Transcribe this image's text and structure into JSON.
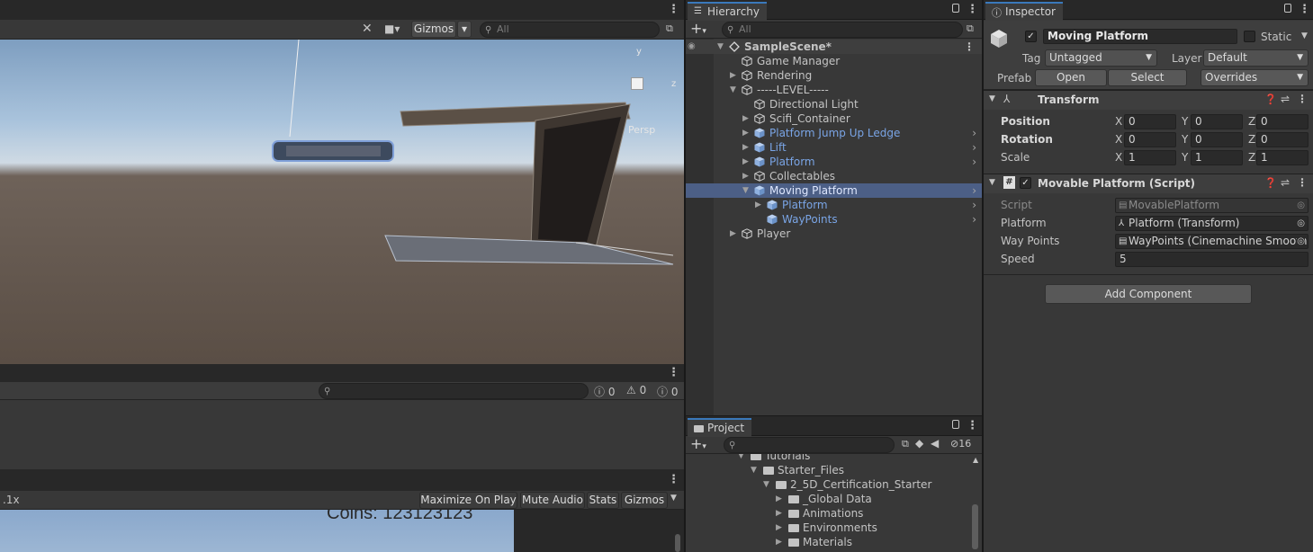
{
  "scene_view": {
    "gizmos_label": "Gizmos",
    "search_placeholder": "All",
    "persp_label": "Persp",
    "axis_y": "y",
    "axis_z": "z"
  },
  "console": {
    "count_info": "0",
    "count_warn": "0",
    "count_error": "0"
  },
  "game_view": {
    "scale_label": ".1x",
    "maximize_label": "Maximize On Play",
    "mute_label": "Mute Audio",
    "stats_label": "Stats",
    "gizmos_label": "Gizmos",
    "coins_text": "Coins: 123123123"
  },
  "hierarchy": {
    "tab_label": "Hierarchy",
    "search_placeholder": "All",
    "items": [
      {
        "label": "SampleScene*",
        "indent": 0,
        "type": "scene"
      },
      {
        "label": "Game Manager",
        "indent": 1,
        "type": "object"
      },
      {
        "label": "Rendering",
        "indent": 1,
        "type": "object"
      },
      {
        "label": "-----LEVEL-----",
        "indent": 1,
        "type": "object"
      },
      {
        "label": "Directional Light",
        "indent": 2,
        "type": "object"
      },
      {
        "label": "Scifi_Container",
        "indent": 2,
        "type": "object"
      },
      {
        "label": "Platform Jump Up Ledge",
        "indent": 2,
        "type": "prefab"
      },
      {
        "label": "Lift",
        "indent": 2,
        "type": "prefab"
      },
      {
        "label": "Platform",
        "indent": 2,
        "type": "prefab"
      },
      {
        "label": "Collectables",
        "indent": 2,
        "type": "object"
      },
      {
        "label": "Moving Platform",
        "indent": 2,
        "type": "prefab",
        "selected": true
      },
      {
        "label": "Platform",
        "indent": 3,
        "type": "prefab"
      },
      {
        "label": "WayPoints",
        "indent": 3,
        "type": "prefab"
      },
      {
        "label": "Player",
        "indent": 1,
        "type": "object"
      }
    ]
  },
  "project": {
    "tab_label": "Project",
    "hidden_count": "16",
    "items": [
      {
        "label": "Tutorials",
        "indent": 0
      },
      {
        "label": "Starter_Files",
        "indent": 1
      },
      {
        "label": "2_5D_Certification_Starter",
        "indent": 2
      },
      {
        "label": "_Global Data",
        "indent": 3
      },
      {
        "label": "Animations",
        "indent": 3
      },
      {
        "label": "Environments",
        "indent": 3
      },
      {
        "label": "Materials",
        "indent": 3
      }
    ]
  },
  "inspector": {
    "tab_label": "Inspector",
    "object_name": "Moving Platform",
    "static_label": "Static",
    "tag_label": "Tag",
    "tag_value": "Untagged",
    "layer_label": "Layer",
    "layer_value": "Default",
    "prefab_label": "Prefab",
    "open_label": "Open",
    "select_label": "Select",
    "overrides_label": "Overrides",
    "transform": {
      "title": "Transform",
      "position_label": "Position",
      "rotation_label": "Rotation",
      "scale_label": "Scale",
      "position": {
        "x": "0",
        "y": "0",
        "z": "0"
      },
      "rotation": {
        "x": "0",
        "y": "0",
        "z": "0"
      },
      "scale": {
        "x": "1",
        "y": "1",
        "z": "1"
      }
    },
    "script_component": {
      "title": "Movable Platform (Script)",
      "script_label": "Script",
      "script_value": "MovablePlatform",
      "platform_label": "Platform",
      "platform_value": "Platform (Transform)",
      "waypoints_label": "Way Points",
      "waypoints_value": "WayPoints (Cinemachine Smooth",
      "speed_label": "Speed",
      "speed_value": "5"
    },
    "add_component_label": "Add Component"
  },
  "colors": {
    "accent": "#3a79bb",
    "selection": "#4c5f86",
    "prefab_blue": "#7aa5e6"
  }
}
